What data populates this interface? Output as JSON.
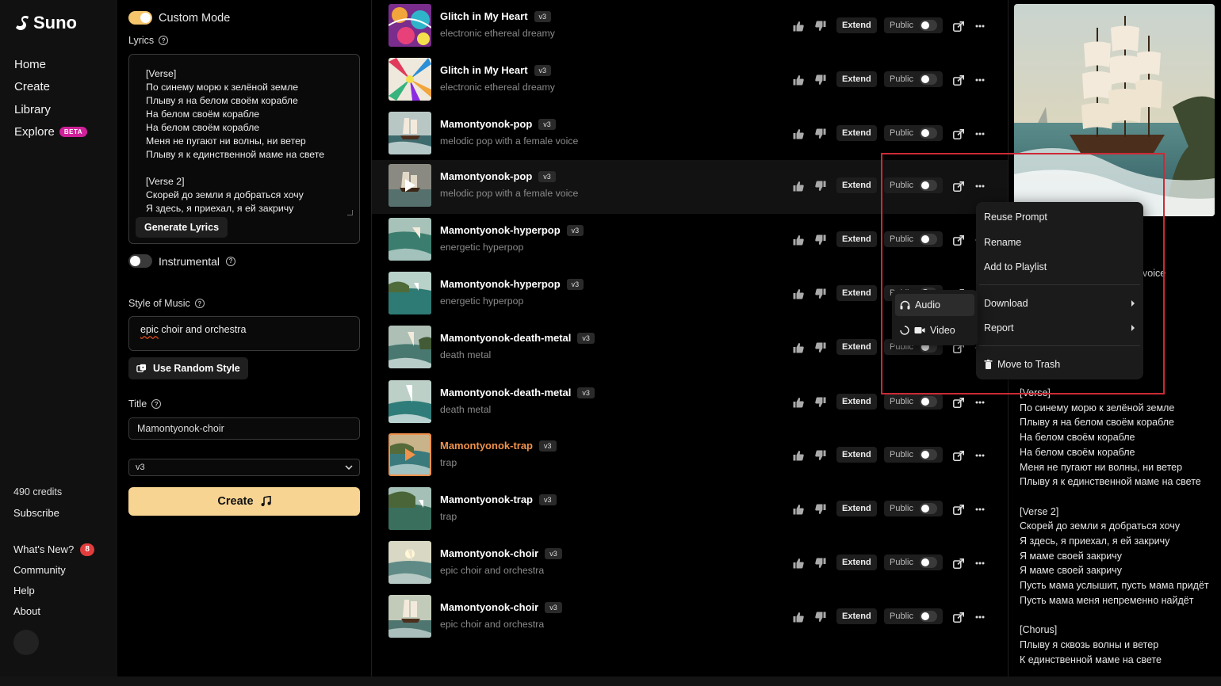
{
  "sidebar": {
    "logo": "Suno",
    "nav": [
      {
        "label": "Home"
      },
      {
        "label": "Create"
      },
      {
        "label": "Library"
      },
      {
        "label": "Explore",
        "badge": "BETA"
      }
    ],
    "credits": "490 credits",
    "subscribe": "Subscribe",
    "bottom": [
      {
        "label": "What's New?",
        "badge": "8"
      },
      {
        "label": "Community"
      },
      {
        "label": "Help"
      },
      {
        "label": "About"
      }
    ]
  },
  "create": {
    "custom_mode": {
      "label": "Custom Mode",
      "on": true
    },
    "lyrics_label": "Lyrics",
    "lyrics_text": "[Verse]\nПо синему морю к зелёной земле\nПлыву я на белом своём корабле\nНа белом своём корабле\nНа белом своём корабле\nМеня не пугают ни волны, ни ветер\nПлыву я к единственной маме на свете\n\n[Verse 2]\nСкорей до земли я добраться хочу\nЯ здесь, я приехал, я ей закричу",
    "generate_lyrics": "Generate Lyrics",
    "instrumental": {
      "label": "Instrumental",
      "on": false
    },
    "style_label": "Style of Music",
    "style_value_a": "epic",
    "style_value_b": " choir and orchestra",
    "random_style": "Use Random Style",
    "title_label": "Title",
    "title_value": "Mamontyonok-choir",
    "version": "v3",
    "create_button": "Create"
  },
  "songs": [
    {
      "title": "Glitch in My Heart",
      "version": "v3",
      "style": "electronic ethereal dreamy",
      "thumb": "psy1"
    },
    {
      "title": "Glitch in My Heart",
      "version": "v3",
      "style": "electronic ethereal dreamy",
      "thumb": "psy2"
    },
    {
      "title": "Mamontyonok-pop",
      "version": "v3",
      "style": "melodic pop with a female voice",
      "thumb": "ship1"
    },
    {
      "title": "Mamontyonok-pop",
      "version": "v3",
      "style": "melodic pop with a female voice",
      "thumb": "ship2",
      "active": true
    },
    {
      "title": "Mamontyonok-hyperpop",
      "version": "v3",
      "style": "energetic hyperpop",
      "thumb": "sea1"
    },
    {
      "title": "Mamontyonok-hyperpop",
      "version": "v3",
      "style": "energetic hyperpop",
      "thumb": "sea2"
    },
    {
      "title": "Mamontyonok-death-metal",
      "version": "v3",
      "style": "death metal",
      "thumb": "sea3"
    },
    {
      "title": "Mamontyonok-death-metal",
      "version": "v3",
      "style": "death metal",
      "thumb": "sea4"
    },
    {
      "title": "Mamontyonok-trap",
      "version": "v3",
      "style": "trap",
      "thumb": "sea5",
      "playing": true
    },
    {
      "title": "Mamontyonok-trap",
      "version": "v3",
      "style": "trap",
      "thumb": "sea6"
    },
    {
      "title": "Mamontyonok-choir",
      "version": "v3",
      "style": "epic choir and orchestra",
      "thumb": "sea7"
    },
    {
      "title": "Mamontyonok-choir",
      "version": "v3",
      "style": "epic choir and orchestra",
      "thumb": "ship3"
    }
  ],
  "actions": {
    "extend": "Extend",
    "public": "Public"
  },
  "context_menu": {
    "items": [
      "Reuse Prompt",
      "Rename",
      "Add to Playlist",
      "Download",
      "Report",
      "Move to Trash"
    ]
  },
  "download_submenu": {
    "items": [
      "Audio",
      "Video"
    ]
  },
  "right_panel": {
    "voice_peek": "voice",
    "lyrics": "[Verse]\nПо синему морю к зелёной земле\nПлыву я на белом своём корабле\nНа белом своём корабле\nНа белом своём корабле\nМеня не пугают ни волны, ни ветер\nПлыву я к единственной маме на свете\n\n[Verse 2]\nСкорей до земли я добраться хочу\nЯ здесь, я приехал, я ей закричу\nЯ маме своей закричу\nЯ маме своей закричу\nПусть мама услышит, пусть мама придёт\nПусть мама меня непременно найдёт\n\n[Chorus]\nПлыву я сквозь волны и ветер\nК единственной маме на свете"
  },
  "colors": {
    "accent": "#f7d491",
    "highlight": "#f0924c",
    "annotation": "#cc2a35",
    "beta": "#d0219a"
  }
}
